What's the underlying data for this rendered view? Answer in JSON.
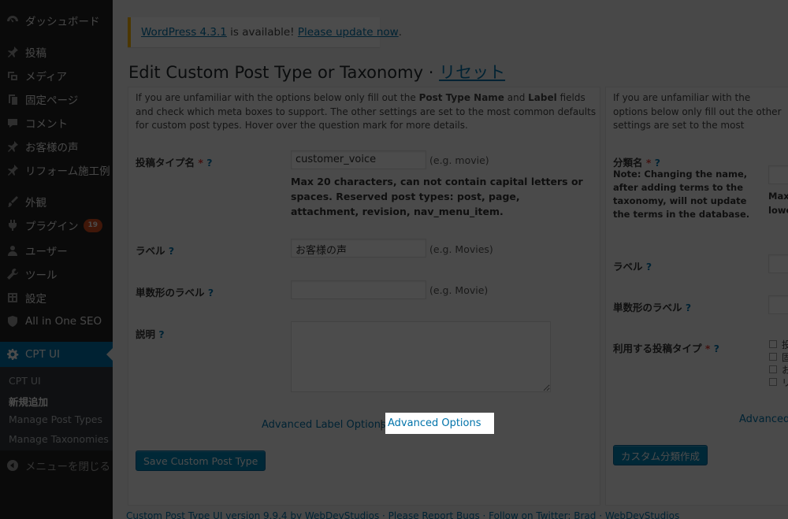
{
  "sidebar": {
    "items": [
      {
        "icon": "dashboard-icon",
        "label": "ダッシュボード"
      },
      {
        "icon": "pin-icon",
        "label": "投稿"
      },
      {
        "icon": "media-icon",
        "label": "メディア"
      },
      {
        "icon": "page-icon",
        "label": "固定ページ"
      },
      {
        "icon": "comment-icon",
        "label": "コメント"
      },
      {
        "icon": "pin-icon",
        "label": "お客様の声"
      },
      {
        "icon": "pin-icon",
        "label": "リフォーム施工例"
      },
      {
        "icon": "appearance-icon",
        "label": "外観"
      },
      {
        "icon": "plugin-icon",
        "label": "プラグイン",
        "badge": "19"
      },
      {
        "icon": "user-icon",
        "label": "ユーザー"
      },
      {
        "icon": "tools-icon",
        "label": "ツール"
      },
      {
        "icon": "settings-icon",
        "label": "設定"
      },
      {
        "icon": "shield-icon",
        "label": "All in One SEO"
      },
      {
        "icon": "gear-icon",
        "label": "CPT UI"
      }
    ],
    "submenu": [
      "CPT UI",
      "新規追加",
      "Manage Post Types",
      "Manage Taxonomies"
    ],
    "collapse_label": "メニューを閉じる"
  },
  "notice": {
    "link1": "WordPress 4.3.1",
    "middle": " is available! ",
    "link2": "Please update now",
    "end": "."
  },
  "title": {
    "text": "Edit Custom Post Type or Taxonomy · ",
    "reset": "リセット"
  },
  "left": {
    "intro_1": "If you are unfamiliar with the options below only fill out the ",
    "intro_b1": "Post Type Name",
    "intro_2": " and ",
    "intro_b2": "Label",
    "intro_3": " fields and check which meta boxes to support. The other settings are set to the most common defaults for custom post types. Hover over the question mark for more details.",
    "post_type_name_label": "投稿タイプ名",
    "post_type_name_value": "customer_voice",
    "post_type_name_hint": "(e.g. movie)",
    "post_type_help": "Max 20 characters, can not contain capital letters or spaces. Reserved post types: post, page, attachment, revision, nav_menu_item.",
    "label_label": "ラベル",
    "label_value": "お客様の声",
    "label_hint": "(e.g. Movies)",
    "singular_label": "単数形のラベル",
    "singular_value": "",
    "singular_hint": "(e.g. Movie)",
    "description_label": "説明",
    "adv_label_options": "Advanced Label Options",
    "separator": "|",
    "adv_options": "Advanced Options",
    "save_button": "Save Custom Post Type"
  },
  "right": {
    "intro": "If you are unfamiliar with the options below only fill out the other settings are set to the most common defaults for more details.",
    "taxonomy_name_label": "分類名",
    "taxonomy_note": "Note: Changing the name, after adding terms to the taxonomy, will not update the terms in the database.",
    "max_hint": "Max",
    "lower_hint": "lowe",
    "label_label": "ラベル",
    "singular_label": "単数形のラベル",
    "post_types_label": "利用する投稿タイプ",
    "checkbox_labels": [
      "投",
      "固",
      "お",
      "リ"
    ],
    "advanced_link": "Advanced",
    "create_button": "カスタム分類作成"
  },
  "footer": {
    "text": "Custom Post Type UI version 9.9.4 by WebDevStudios · Please Report Bugs · Follow on Twitter: Brad · WebDevStudios"
  },
  "colors": {
    "sidebar": "#222222",
    "accent": "#0073aa",
    "button": "#0085ba",
    "notice": "#ffba00"
  }
}
